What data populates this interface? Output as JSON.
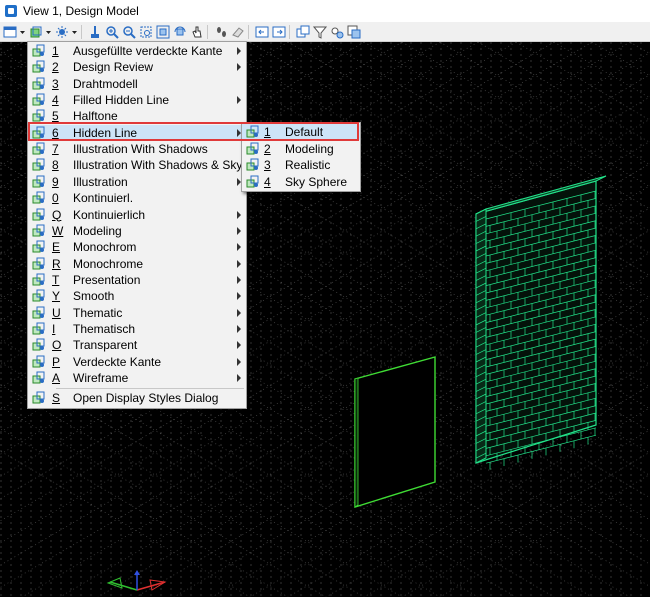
{
  "window": {
    "title": "View 1, Design Model"
  },
  "toolbar": {
    "icons": [
      "view-attributes-icon",
      "dropdown-icon",
      "display-style-icon",
      "dropdown-icon",
      "light-icon",
      "dropdown-icon",
      "update-icon",
      "zoom-in-icon",
      "zoom-out-icon",
      "window-area-icon",
      "fit-view-icon",
      "rotate-view-icon",
      "pan-icon",
      "walk-icon",
      "eraser-icon",
      "view-previous-icon",
      "view-next-icon",
      "copy-view-icon",
      "clip-volume-icon",
      "camera-icon",
      "presentation-icon"
    ]
  },
  "menu": {
    "items": [
      {
        "key": "1",
        "label": "Ausgefüllte verdeckte Kante",
        "submenu": true
      },
      {
        "key": "2",
        "label": "Design Review",
        "submenu": true
      },
      {
        "key": "3",
        "label": "Drahtmodell",
        "submenu": false
      },
      {
        "key": "4",
        "label": "Filled Hidden Line",
        "submenu": true
      },
      {
        "key": "5",
        "label": "Halftone",
        "submenu": false
      },
      {
        "key": "6",
        "label": "Hidden Line",
        "submenu": true
      },
      {
        "key": "7",
        "label": "Illustration With Shadows",
        "submenu": false
      },
      {
        "key": "8",
        "label": "Illustration With Shadows & Sky",
        "submenu": false
      },
      {
        "key": "9",
        "label": "Illustration",
        "submenu": true
      },
      {
        "key": "0",
        "label": "Kontinuierl.",
        "submenu": false
      },
      {
        "key": "Q",
        "label": "Kontinuierlich",
        "submenu": true
      },
      {
        "key": "W",
        "label": "Modeling",
        "submenu": true
      },
      {
        "key": "E",
        "label": "Monochrom",
        "submenu": true
      },
      {
        "key": "R",
        "label": "Monochrome",
        "submenu": true
      },
      {
        "key": "T",
        "label": "Presentation",
        "submenu": true
      },
      {
        "key": "Y",
        "label": "Smooth",
        "submenu": true
      },
      {
        "key": "U",
        "label": "Thematic",
        "submenu": true
      },
      {
        "key": "I",
        "label": "Thematisch",
        "submenu": true
      },
      {
        "key": "O",
        "label": "Transparent",
        "submenu": true
      },
      {
        "key": "P",
        "label": "Verdeckte Kante",
        "submenu": true
      },
      {
        "key": "A",
        "label": "Wireframe",
        "submenu": true
      }
    ],
    "footer": {
      "key": "S",
      "label": "Open Display Styles Dialog"
    }
  },
  "submenu": {
    "items": [
      {
        "key": "1",
        "label": "Default"
      },
      {
        "key": "2",
        "label": "Modeling"
      },
      {
        "key": "3",
        "label": "Realistic"
      },
      {
        "key": "4",
        "label": "Sky Sphere"
      }
    ]
  },
  "colors": {
    "background": "#000000",
    "grid": "#6a6a6a",
    "wall": "#22e38a",
    "panel": "#3fdc34",
    "highlight": "#cde4f7",
    "highlight_border": "#e03a3a",
    "axis_x": "#e03030",
    "axis_y": "#30c030",
    "axis_z": "#3050e0"
  }
}
